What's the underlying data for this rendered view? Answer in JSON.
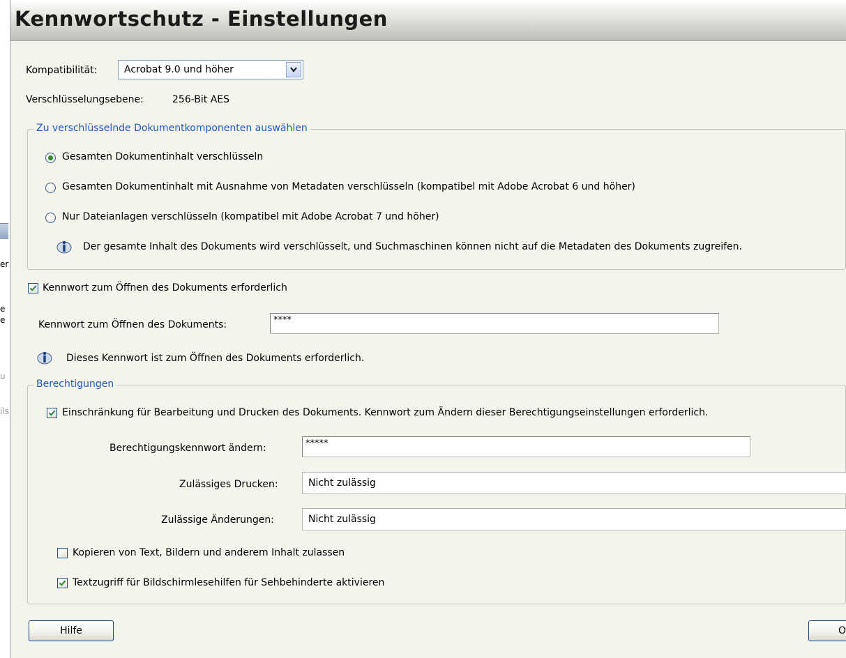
{
  "background_window": {
    "fragments": [
      "er",
      "e",
      "e",
      "u",
      "ils"
    ]
  },
  "dialog": {
    "title": "Kennwortschutz - Einstellungen",
    "compatibility": {
      "label": "Kompatibilität:",
      "selected": "Acrobat 9.0 und höher"
    },
    "encryption_level": {
      "label": "Verschlüsselungsebene:",
      "value": "256-Bit AES"
    },
    "components_group": {
      "legend": "Zu verschlüsselnde Dokumentkomponenten auswählen",
      "options": [
        {
          "label": "Gesamten Dokumentinhalt verschlüsseln",
          "selected": true
        },
        {
          "label": "Gesamten Dokumentinhalt mit Ausnahme von Metadaten verschlüsseln (kompatibel mit Adobe Acrobat 6 und höher)",
          "selected": false
        },
        {
          "label": "Nur Dateianlagen verschlüsseln (kompatibel mit Adobe Acrobat 7 und höher)",
          "selected": false
        }
      ],
      "info": "Der gesamte Inhalt des Dokuments wird verschlüsselt, und Suchmaschinen können nicht auf die Metadaten des Dokuments zugreifen."
    },
    "open_password": {
      "checkbox_label": "Kennwort zum Öffnen des Dokuments erforderlich",
      "checked": true,
      "field_label": "Kennwort zum Öffnen des Dokuments:",
      "value": "****",
      "info": "Dieses Kennwort ist zum Öffnen des Dokuments erforderlich."
    },
    "permissions_group": {
      "legend": "Berechtigungen",
      "restrict_label": "Einschränkung für Bearbeitung und Drucken des Dokuments. Kennwort zum Ändern dieser Berechtigungseinstellungen erforderlich.",
      "restrict_checked": true,
      "permissions_password_label": "Berechtigungskennwort ändern:",
      "permissions_password_value": "*****",
      "printing_label": "Zulässiges Drucken:",
      "printing_value": "Nicht zulässig",
      "changes_label": "Zulässige Änderungen:",
      "changes_value": "Nicht zulässig",
      "copy_label": "Kopieren von Text, Bildern und anderem Inhalt zulassen",
      "copy_checked": false,
      "screenreader_label": "Textzugriff für Bildschirmlesehilfen für Sehbehinderte aktivieren",
      "screenreader_checked": true
    },
    "buttons": {
      "help": "Hilfe",
      "ok_partial": "O"
    }
  },
  "colors": {
    "legend": "#1c58cc",
    "dialog_bg": "#f5f4ec",
    "check_mark": "#2c8a2c"
  }
}
